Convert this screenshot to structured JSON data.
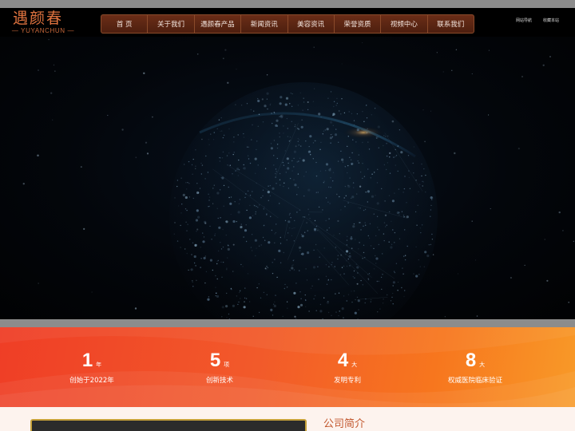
{
  "brand": {
    "name_cn": "遇颜春",
    "name_en": "— YUYANCHUN —",
    "accent": "#e0733f"
  },
  "nav": {
    "items": [
      "首 页",
      "关于我们",
      "遇颜春产品",
      "新闻资讯",
      "美容资讯",
      "荣誉资质",
      "视频中心",
      "联系我们"
    ],
    "background": "#5a2512"
  },
  "utility_links": {
    "sitemap": "网站导航",
    "favorite": "收藏本站"
  },
  "hero": {
    "graphic": "dotted-globe"
  },
  "stats": [
    {
      "number": "1",
      "unit": "年",
      "label": "创始于2022年"
    },
    {
      "number": "5",
      "unit": "项",
      "label": "创新技术"
    },
    {
      "number": "4",
      "unit": "大",
      "label": "发明专利"
    },
    {
      "number": "8",
      "unit": "大",
      "label": "权威医院临床验证"
    }
  ],
  "about": {
    "title": "公司简介"
  }
}
